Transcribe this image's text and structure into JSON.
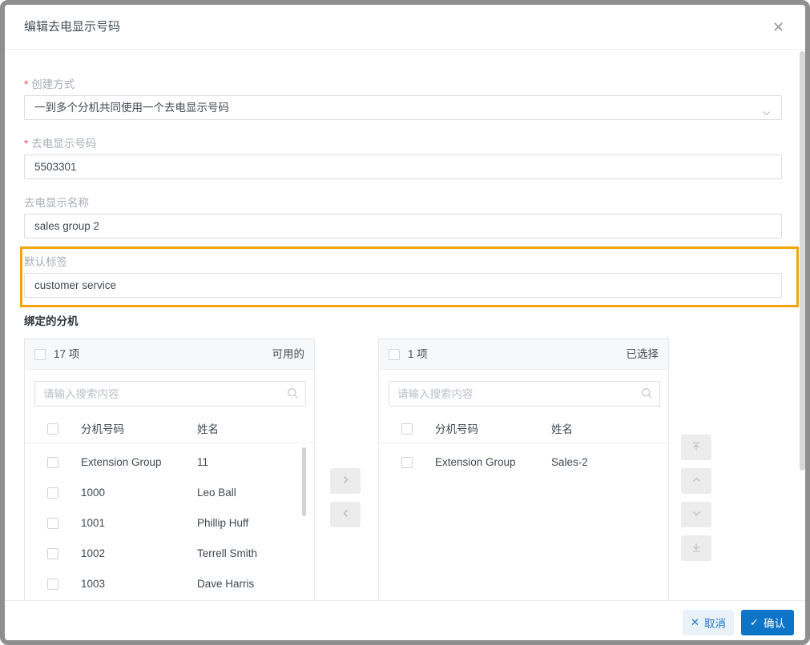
{
  "dialog": {
    "title": "编辑去电显示号码",
    "close_glyph": "✕"
  },
  "form": {
    "required_marker": "*",
    "creation_method": {
      "label": "创建方式",
      "value": "一到多个分机共同使用一个去电显示号码"
    },
    "display_number": {
      "label": "去电显示号码",
      "value": "5503301"
    },
    "display_name": {
      "label": "去电显示名称",
      "value": "sales group 2"
    },
    "default_label": {
      "label": "默认标签",
      "value": "customer service"
    },
    "section_title": "绑定的分机"
  },
  "transfer": {
    "search_placeholder": "请输入搜索内容",
    "columns": [
      "分机号码",
      "姓名"
    ],
    "available": {
      "count": "17 项",
      "title": "可用的",
      "rows": [
        {
          "number": "Extension Group",
          "name": "11"
        },
        {
          "number": "1000",
          "name": "Leo Ball"
        },
        {
          "number": "1001",
          "name": "Phillip Huff"
        },
        {
          "number": "1002",
          "name": "Terrell Smith"
        },
        {
          "number": "1003",
          "name": "Dave Harris"
        }
      ]
    },
    "selected": {
      "count": "1 项",
      "title": "已选择",
      "rows": [
        {
          "number": "Extension Group",
          "name": "Sales-2"
        }
      ]
    }
  },
  "footer": {
    "cancel": {
      "glyph": "✕",
      "label": "取消"
    },
    "confirm": {
      "glyph": "✓",
      "label": "确认"
    }
  },
  "colors": {
    "confirm_blue": "#0d74c7",
    "cancel_bg": "#e9f1f9",
    "cancel_text": "#2478ca",
    "highlight_orange": "#f2a50a",
    "window_border": "#8f8f8f"
  }
}
